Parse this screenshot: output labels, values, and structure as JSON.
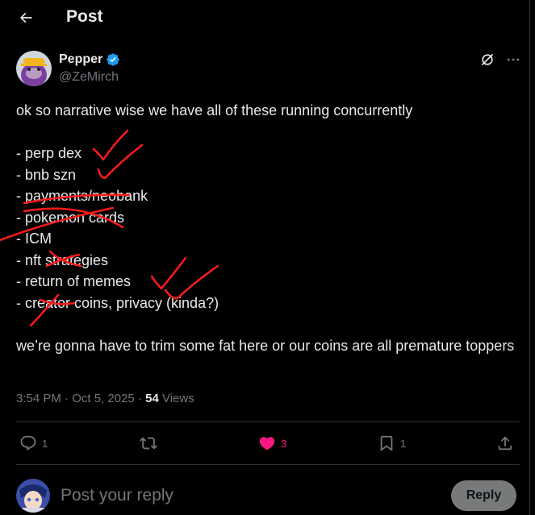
{
  "header": {
    "title": "Post"
  },
  "author": {
    "name": "Pepper",
    "handle": "@ZeMirch",
    "verified": true
  },
  "tweet": {
    "intro": "ok so narrative wise we have all of these running concurrently",
    "items": [
      "- perp dex",
      "- bnb szn",
      "- payments/neobank",
      "- pokemon cards",
      "- ICM",
      "- nft strategies",
      "- return of memes",
      "- creator coins, privacy (kinda?)"
    ],
    "outro": "we’re gonna have to trim some fat here or our coins are all premature toppers"
  },
  "meta": {
    "time": "3:54 PM",
    "separator": "·",
    "date": "Oct 5, 2025",
    "views_count": "54",
    "views_label": "Views"
  },
  "actions": {
    "replies": "1",
    "reposts": "",
    "likes": "3",
    "bookmarks": "1"
  },
  "reply": {
    "placeholder": "Post your reply",
    "button": "Reply"
  },
  "colors": {
    "like": "#f91880",
    "verified": "#1d9bf0",
    "annotation": "#ff1a1a"
  }
}
